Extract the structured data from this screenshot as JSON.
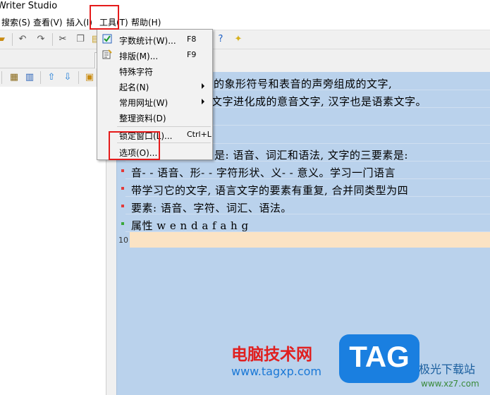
{
  "window": {
    "title": "Writer Studio"
  },
  "menubar": {
    "items": [
      {
        "label": "搜索(S)"
      },
      {
        "label": "查看(V)"
      },
      {
        "label": "插入(I)"
      },
      {
        "label": "工具(T)"
      },
      {
        "label": "帮助(H)"
      }
    ]
  },
  "tools_menu": {
    "items": [
      {
        "label": "字数统计(W)...",
        "shortcut": "F8",
        "icon": "check-icon"
      },
      {
        "label": "排版(M)...",
        "shortcut": "F9",
        "icon": "format-icon"
      },
      {
        "label": "特殊字符",
        "shortcut": ""
      },
      {
        "label": "起名(N)",
        "submenu": true
      },
      {
        "label": "常用网址(W)",
        "submenu": true
      },
      {
        "label": "整理资料(D)",
        "shortcut": ""
      },
      {
        "label": "锁定窗口(L)...",
        "shortcut": "Ctrl+L"
      },
      {
        "label": "选项(O)...",
        "shortcut": ""
      }
    ]
  },
  "editor": {
    "lines": [
      "表义的象形符号和表音的声旁组成的文字,",
      "文字进化成的意音文字, 汉字也是语素文字。",
      "",
      "是: 语音、词汇和语法, 文字的三要素是:",
      "音- - 语音、形- - 字符形状、义- - 意义。学习一门语言",
      "带学习它的文字, 语言文字的要素有重复, 合并同类型为四",
      "要素: 语音、字符、词汇、语法。",
      "属性  w e n d a f a h g"
    ],
    "current_line_number": "10"
  },
  "watermark": {
    "site_name": "电脑技术网",
    "site_url": "www.tagxp.com",
    "tag": "TAG",
    "partner": "极光下载站",
    "partner_url": "www.xz7.com"
  },
  "colors": {
    "highlight_box": "#e51b1b",
    "editor_bg": "#bad2ec",
    "current_line": "#fbe3c4"
  }
}
